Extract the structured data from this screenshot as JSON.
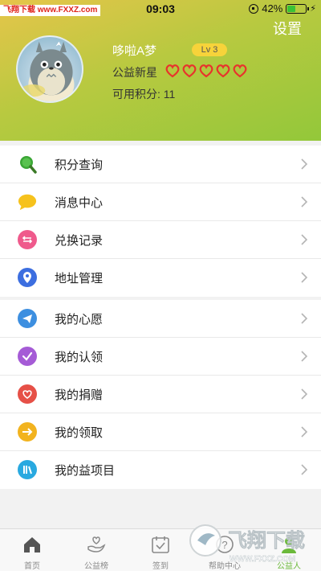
{
  "status_bar": {
    "watermark_brand": "飞翔下载",
    "watermark_url": "www.FXXZ.com",
    "time": "09:03",
    "battery": "42%",
    "battery_level": 0.42
  },
  "profile": {
    "settings_label": "设置",
    "username": "哆啦A梦",
    "level": "Lv 3",
    "star_label": "公益新星",
    "hearts_count": 5,
    "points_label": "可用积分: 11"
  },
  "menu_group_1": [
    {
      "label": "积分查询",
      "icon": "magnifier-icon",
      "color": "#3aa635"
    },
    {
      "label": "消息中心",
      "icon": "chat-bubble-icon",
      "color": "#f6c21d"
    },
    {
      "label": "兑换记录",
      "icon": "exchange-icon",
      "color": "#ef5a8c"
    },
    {
      "label": "地址管理",
      "icon": "location-pin-icon",
      "color": "#3c6ee0"
    }
  ],
  "menu_group_2": [
    {
      "label": "我的心愿",
      "icon": "paper-plane-icon",
      "color": "#3d8fe0"
    },
    {
      "label": "我的认领",
      "icon": "checkmark-icon",
      "color": "#a55bd6"
    },
    {
      "label": "我的捐赠",
      "icon": "heart-icon",
      "color": "#e65047"
    },
    {
      "label": "我的领取",
      "icon": "arrow-right-icon",
      "color": "#f2b31f"
    },
    {
      "label": "我的益项目",
      "icon": "books-icon",
      "color": "#29a9e0"
    }
  ],
  "tabs": [
    {
      "label": "首页",
      "icon": "home-icon"
    },
    {
      "label": "公益榜",
      "icon": "hand-heart-icon"
    },
    {
      "label": "签到",
      "icon": "calendar-check-icon"
    },
    {
      "label": "帮助中心",
      "icon": "help-icon"
    },
    {
      "label": "公益人",
      "icon": "person-icon",
      "active": true
    }
  ],
  "bottom_watermark": {
    "brand": "飞翔下载",
    "url": "WWW.FXXZ.COM"
  }
}
